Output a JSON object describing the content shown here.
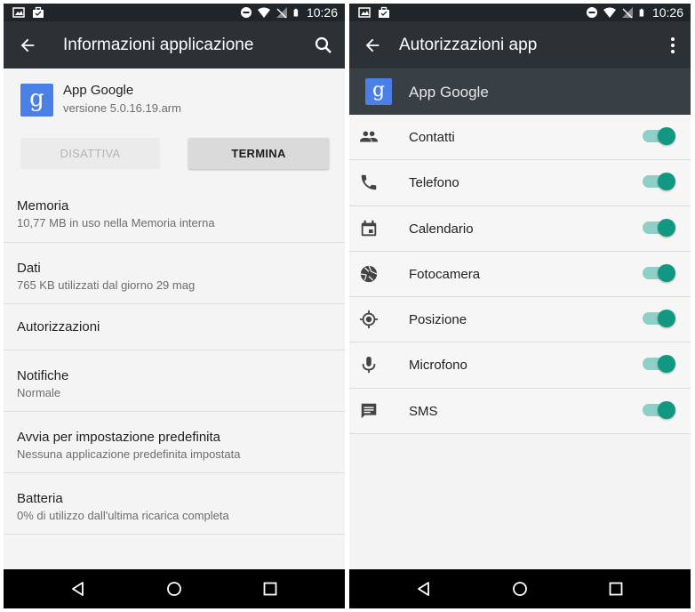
{
  "status_bar": {
    "time": "10:26",
    "left_icons": [
      "image-icon",
      "briefcase-icon"
    ],
    "right_icons": [
      "do-not-disturb-icon",
      "wifi-icon",
      "no-signal-icon",
      "battery-icon"
    ]
  },
  "left_screen": {
    "toolbar": {
      "title": "Informazioni applicazione",
      "back_icon": "arrow-back-icon",
      "action_icon": "search-icon"
    },
    "app": {
      "icon_letter": "g",
      "name": "App Google",
      "version": "versione 5.0.16.19.arm"
    },
    "buttons": {
      "disable_label": "DISATTIVA",
      "terminate_label": "TERMINA"
    },
    "settings": [
      {
        "title": "Memoria",
        "subtitle": "10,77 MB in uso nella Memoria interna"
      },
      {
        "title": "Dati",
        "subtitle": "765 KB utilizzati dal giorno 29 mag"
      },
      {
        "title": "Autorizzazioni",
        "subtitle": ""
      },
      {
        "title": "Notifiche",
        "subtitle": "Normale"
      },
      {
        "title": "Avvia per impostazione predefinita",
        "subtitle": "Nessuna applicazione predefinita impostata"
      },
      {
        "title": "Batteria",
        "subtitle": "0% di utilizzo dall'ultima ricarica completa"
      }
    ]
  },
  "right_screen": {
    "toolbar": {
      "title": "Autorizzazioni app",
      "back_icon": "arrow-back-icon",
      "action_icon": "more-vert-icon"
    },
    "app": {
      "icon_letter": "g",
      "name": "App Google"
    },
    "permissions": [
      {
        "label": "Contatti",
        "icon": "people-icon",
        "enabled": true
      },
      {
        "label": "Telefono",
        "icon": "phone-icon",
        "enabled": true
      },
      {
        "label": "Calendario",
        "icon": "calendar-icon",
        "enabled": true
      },
      {
        "label": "Fotocamera",
        "icon": "camera-icon",
        "enabled": true
      },
      {
        "label": "Posizione",
        "icon": "location-icon",
        "enabled": true
      },
      {
        "label": "Microfono",
        "icon": "microphone-icon",
        "enabled": true
      },
      {
        "label": "SMS",
        "icon": "sms-icon",
        "enabled": true
      }
    ]
  },
  "nav_bar": {
    "buttons": [
      "back-nav-icon",
      "home-nav-icon",
      "recents-nav-icon"
    ]
  },
  "colors": {
    "toolbar": "#2c3135",
    "status_bar": "#1f2528",
    "accent_teal": "#129882",
    "app_icon_blue": "#4a7fe6"
  }
}
